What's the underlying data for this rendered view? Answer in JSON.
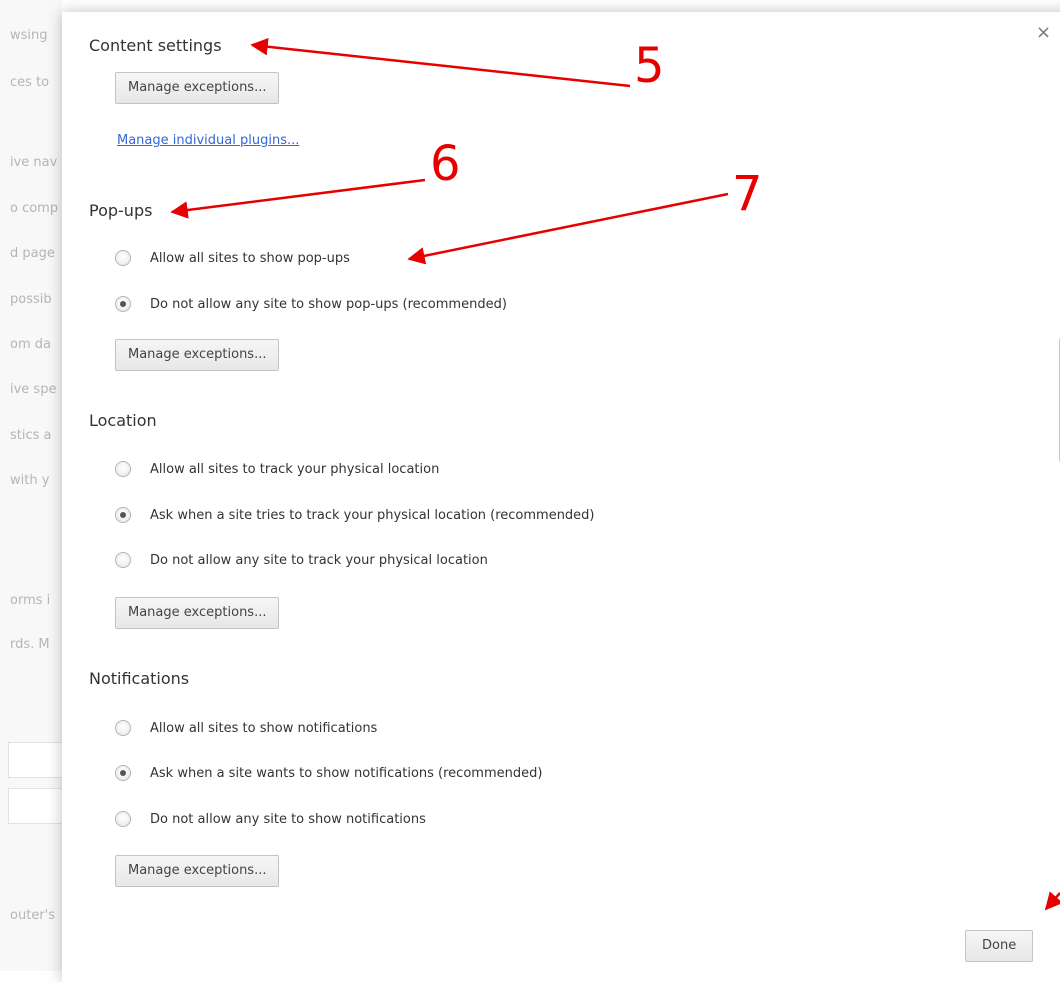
{
  "background_page": {
    "fragments": [
      "wsing",
      "ces to",
      "ive nav",
      "o comp",
      "d page",
      "possib",
      "om da",
      "ive spe",
      "stics a",
      "with y",
      "orms i",
      "rds. M",
      "outer's"
    ]
  },
  "dialog": {
    "title": "Content settings",
    "close_label": "×",
    "plugins": {
      "manage_exceptions_label": "Manage exceptions...",
      "manage_individual_label": "Manage individual plugins..."
    },
    "popups": {
      "heading": "Pop-ups",
      "options": [
        {
          "label": "Allow all sites to show pop-ups",
          "checked": false
        },
        {
          "label": "Do not allow any site to show pop-ups (recommended)",
          "checked": true
        }
      ],
      "manage_exceptions_label": "Manage exceptions..."
    },
    "location": {
      "heading": "Location",
      "options": [
        {
          "label": "Allow all sites to track your physical location",
          "checked": false
        },
        {
          "label": "Ask when a site tries to track your physical location (recommended)",
          "checked": true
        },
        {
          "label": "Do not allow any site to track your physical location",
          "checked": false
        }
      ],
      "manage_exceptions_label": "Manage exceptions..."
    },
    "notifications": {
      "heading": "Notifications",
      "options": [
        {
          "label": "Allow all sites to show notifications",
          "checked": false
        },
        {
          "label": "Ask when a site wants to show notifications (recommended)",
          "checked": true
        },
        {
          "label": "Do not allow any site to show notifications",
          "checked": false
        }
      ],
      "manage_exceptions_label": "Manage exceptions..."
    },
    "done_label": "Done"
  },
  "annotations": {
    "labels": [
      "5",
      "6",
      "7"
    ],
    "color": "#e60000"
  }
}
